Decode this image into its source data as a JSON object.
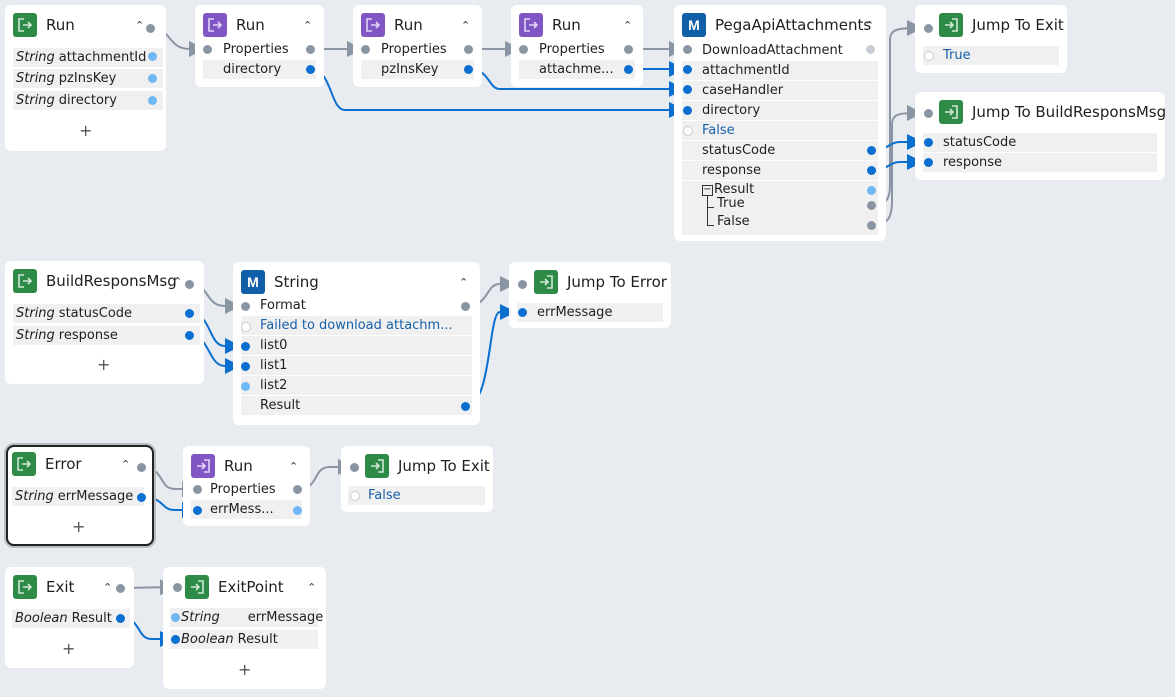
{
  "nodes": {
    "run1": {
      "title": "Run",
      "icon": "exit-icon",
      "params": [
        {
          "type": "String",
          "name": "attachmentId"
        },
        {
          "type": "String",
          "name": "pzInsKey"
        },
        {
          "type": "String",
          "name": "directory"
        }
      ],
      "add": "+"
    },
    "run2": {
      "title": "Run",
      "icon": "enter-icon",
      "rows": [
        "Properties",
        "directory"
      ]
    },
    "run3": {
      "title": "Run",
      "icon": "enter-icon",
      "rows": [
        "Properties",
        "pzInsKey"
      ]
    },
    "run4": {
      "title": "Run",
      "icon": "enter-icon",
      "rows": [
        "Properties",
        "attachme..."
      ]
    },
    "pega": {
      "title": "PegaApiAttachments",
      "badge": "M",
      "rows": [
        "DownloadAttachment",
        "attachmentId",
        "caseHandler",
        "directory",
        "False",
        "statusCode",
        "response",
        "Result",
        "True",
        "False"
      ]
    },
    "jumpExit1": {
      "title": "Jump To Exit",
      "value": "True"
    },
    "jumpBuild": {
      "title": "Jump To BuildResponsMsg",
      "rows": [
        "statusCode",
        "response"
      ]
    },
    "build": {
      "title": "BuildResponsMsg",
      "params": [
        {
          "type": "String",
          "name": "statusCode"
        },
        {
          "type": "String",
          "name": "response"
        }
      ],
      "add": "+"
    },
    "string": {
      "title": "String",
      "badge": "M",
      "rows": [
        "Format",
        "Failed to download attachm...",
        "list0",
        "list1",
        "list2",
        "Result"
      ]
    },
    "jumpError": {
      "title": "Jump To Error",
      "rows": [
        "errMessage"
      ]
    },
    "error": {
      "title": "Error",
      "params": [
        {
          "type": "String",
          "name": "errMessage"
        }
      ],
      "add": "+"
    },
    "run5": {
      "title": "Run",
      "rows": [
        "Properties",
        "errMess..."
      ]
    },
    "jumpExit2": {
      "title": "Jump To Exit",
      "value": "False"
    },
    "exit": {
      "title": "Exit",
      "params": [
        {
          "type": "Boolean",
          "name": "Result"
        }
      ],
      "add": "+"
    },
    "exitPoint": {
      "title": "ExitPoint",
      "params": [
        {
          "type": "String",
          "name": "errMessage"
        },
        {
          "type": "Boolean",
          "name": "Result"
        }
      ],
      "add": "+"
    }
  },
  "colors": {
    "canvas": "#e8ecf0",
    "green": "#2e8b47",
    "purple": "#8055c4",
    "blue": "#105fa8",
    "wire_flow": "#8a95a3",
    "wire_data": "#0b6fd0"
  }
}
